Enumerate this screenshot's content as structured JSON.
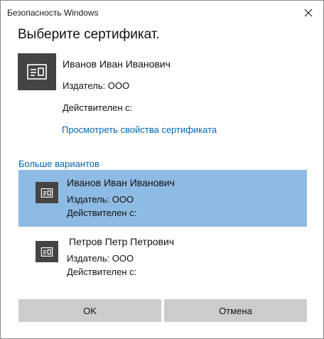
{
  "window": {
    "title": "Безопасность Windows",
    "close_icon": "close-icon"
  },
  "heading": "Выберите сертификат.",
  "selected_certificate": {
    "icon": "certificate-icon",
    "name": "Иванов Иван Иванович",
    "issuer": "Издатель: ООО",
    "valid_from": "Действителен с:",
    "properties_link": "Просмотреть свойства сертификата"
  },
  "more_options_label": "Больше вариантов",
  "certificates": [
    {
      "icon": "certificate-icon",
      "name": "Иванов Иван Иванович",
      "issuer": "Издатель: ООО",
      "valid_from": "Действителен с:",
      "selected": true
    },
    {
      "icon": "certificate-icon",
      "name": "Петров Петр Петрович",
      "issuer": "Издатель: ООО",
      "valid_from": "Действителен с:",
      "selected": false
    }
  ],
  "buttons": {
    "ok": "OK",
    "cancel": "Отмена"
  },
  "colors": {
    "link": "#0066b4",
    "selection": "#8ebbe3",
    "tile": "#444444",
    "button": "#cccccc"
  }
}
